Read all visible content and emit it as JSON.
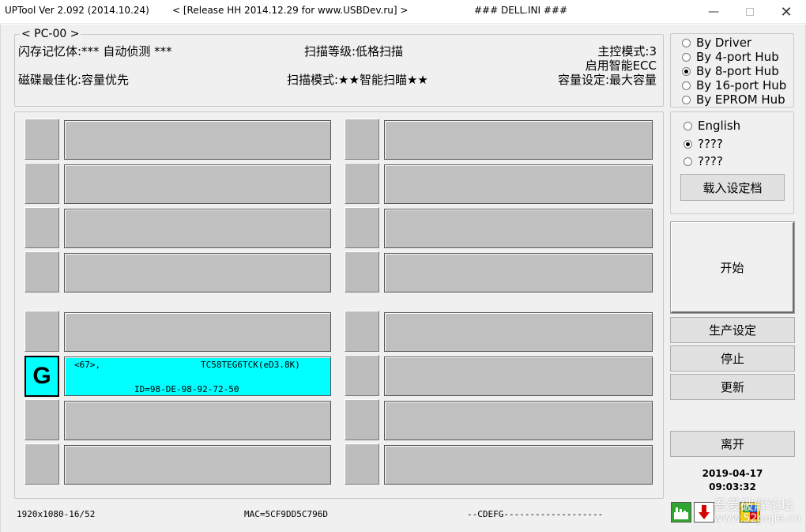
{
  "title": {
    "app": "UPTool Ver 2.092 (2014.10.24)",
    "release": "< [Release HH 2014.12.29 for www.USBDev.ru] >",
    "ini": "### DELL.INI ###"
  },
  "info": {
    "legend": "< PC-00 >",
    "flash": "闪存记忆体:*** 自动侦测 ***",
    "scan_level": "扫描等级:低格扫描",
    "master_mode": "主控模式:3",
    "ecc": "启用智能ECC",
    "disk_opt": "磁碟最佳化:容量优先",
    "scan_mode": "扫描模式:★★智能扫瞄★★",
    "capacity": "容量设定:最大容量"
  },
  "drivers": [
    {
      "label": "By Driver",
      "selected": false
    },
    {
      "label": "By 4-port Hub",
      "selected": false
    },
    {
      "label": "By 8-port Hub",
      "selected": true
    },
    {
      "label": "By 16-port Hub",
      "selected": false
    },
    {
      "label": "By EPROM Hub",
      "selected": false
    }
  ],
  "languages": [
    {
      "label": "English",
      "selected": false
    },
    {
      "label": "????",
      "selected": true
    },
    {
      "label": "????",
      "selected": false
    }
  ],
  "buttons": {
    "load_settings": "载入设定档",
    "start": "开始",
    "prod_settings": "生产设定",
    "stop": "停止",
    "update": "更新",
    "exit": "离开"
  },
  "active_port": {
    "letter": "G",
    "line1_left": "<67>,",
    "line1_right": "TC58TEG6TCK(eD3.8K)",
    "line2": "ID=98-DE-98-92-72-50"
  },
  "datetime": {
    "date": "2019-04-17",
    "time": "09:03:32"
  },
  "statusbar": {
    "resolution": "1920x1080-16/52",
    "mac": "MAC=5CF9DD5C796D",
    "drives": "--CDEFG-------------------"
  },
  "watermark": {
    "line1": "吾爱破解论坛",
    "line2": "www.52pojie.cn"
  },
  "colors": {
    "active_slot": "#00ffff",
    "slot": "#c0c0c0"
  }
}
